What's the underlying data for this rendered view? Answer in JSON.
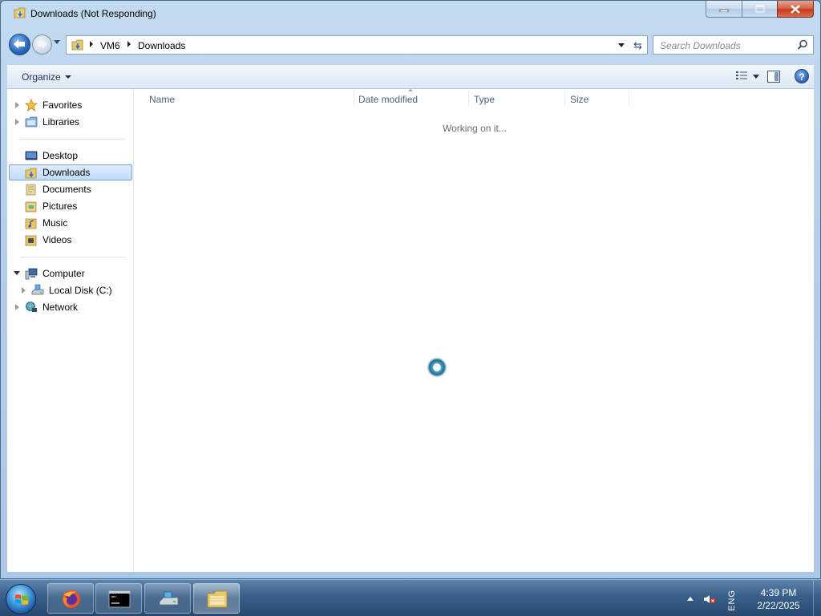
{
  "window": {
    "title": "Downloads (Not Responding)"
  },
  "address": {
    "crumbs": [
      "VM6",
      "Downloads"
    ]
  },
  "search": {
    "placeholder": "Search Downloads"
  },
  "toolbar": {
    "organize_label": "Organize",
    "help_label": "?"
  },
  "navpane": {
    "favorites": "Favorites",
    "libraries": "Libraries",
    "items": [
      {
        "label": "Desktop",
        "icon": "desktop-icon"
      },
      {
        "label": "Downloads",
        "icon": "downloads-folder-icon",
        "selected": true
      },
      {
        "label": "Documents",
        "icon": "documents-icon"
      },
      {
        "label": "Pictures",
        "icon": "pictures-icon"
      },
      {
        "label": "Music",
        "icon": "music-icon"
      },
      {
        "label": "Videos",
        "icon": "videos-icon"
      }
    ],
    "computer": "Computer",
    "local_disk": "Local Disk (C:)",
    "network": "Network"
  },
  "files": {
    "columns": [
      "Name",
      "Date modified",
      "Type",
      "Size"
    ],
    "status": "Working on it..."
  },
  "taskbar": {
    "apps": [
      "firefox-icon",
      "command-prompt-icon",
      "network-drive-icon",
      "file-explorer-icon"
    ],
    "language": "ENG",
    "time": "4:39 PM",
    "date": "2/22/2025"
  },
  "colors": {
    "selection": "#c1dcfc",
    "close_button": "#c33a1d",
    "taskbar": "#27496f"
  }
}
